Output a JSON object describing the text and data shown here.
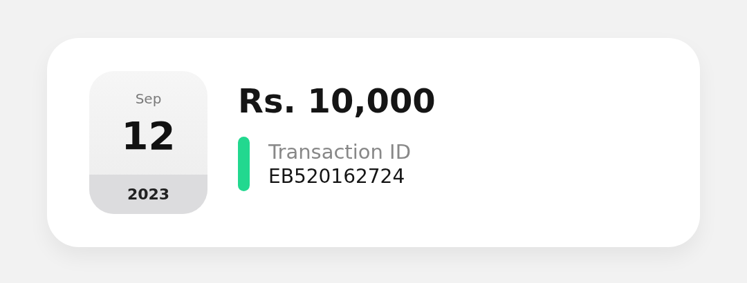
{
  "date": {
    "month": "Sep",
    "day": "12",
    "year": "2023"
  },
  "amount": "Rs. 10,000",
  "transaction": {
    "label": "Transaction ID",
    "value": "EB520162724"
  }
}
